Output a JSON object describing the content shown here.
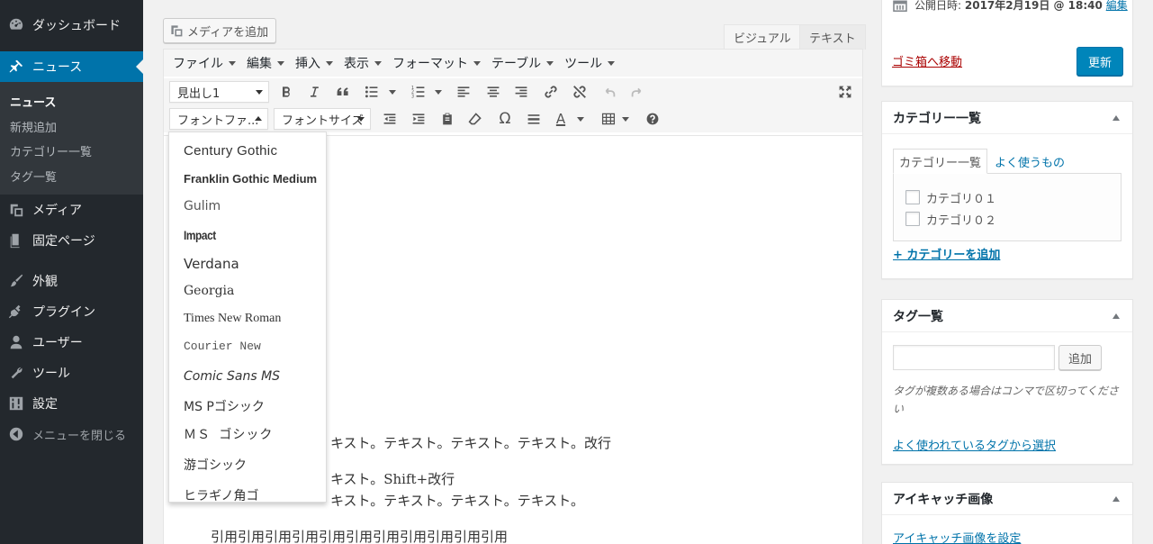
{
  "sidebar": {
    "items": [
      {
        "label": "ダッシュボード",
        "icon": "dashboard-icon"
      },
      {
        "label": "ニュース",
        "icon": "pin-icon",
        "active": true
      },
      {
        "label": "メディア",
        "icon": "media-icon"
      },
      {
        "label": "固定ページ",
        "icon": "page-icon"
      },
      {
        "label": "外観",
        "icon": "brush-icon"
      },
      {
        "label": "プラグイン",
        "icon": "plugin-icon"
      },
      {
        "label": "ユーザー",
        "icon": "user-icon"
      },
      {
        "label": "ツール",
        "icon": "wrench-icon"
      },
      {
        "label": "設定",
        "icon": "settings-icon"
      }
    ],
    "submenu": [
      "ニュース",
      "新規追加",
      "カテゴリー一覧",
      "タグ一覧"
    ],
    "collapse_label": "メニューを閉じる"
  },
  "editor": {
    "add_media_label": "メディアを追加",
    "tab_visual": "ビジュアル",
    "tab_text": "テキスト",
    "menubar": [
      "ファイル",
      "編集",
      "挿入",
      "表示",
      "フォーマット",
      "テーブル",
      "ツール"
    ],
    "format_select": "見出し1",
    "font_family_select": "フォントファ...",
    "font_size_select": "フォントサイズ",
    "text_color_glyph": "A",
    "omega_glyph": "Ω",
    "content_lines": [
      "キスト。テキスト。テキスト。テキスト。改行",
      "キスト。Shift+改行",
      "キスト。テキスト。テキスト。テキスト。",
      "引用引用引用引用引用引用引用引用引用引用引用"
    ]
  },
  "font_dropdown": {
    "options": [
      {
        "label": "Century Gothic"
      },
      {
        "label": "Franklin Gothic Medium"
      },
      {
        "label": "Gulim"
      },
      {
        "label": "Impact"
      },
      {
        "label": "Verdana"
      },
      {
        "label": "Georgia"
      },
      {
        "label": "Times New Roman"
      },
      {
        "label": "Courier New"
      },
      {
        "label": "Comic Sans MS"
      },
      {
        "label": "MS Pゴシック"
      },
      {
        "label": "ＭＳ ゴシック"
      },
      {
        "label": "游ゴシック"
      },
      {
        "label": "ヒラギノ角ゴ"
      }
    ]
  },
  "publish": {
    "publish_date_label": "公開日時:",
    "publish_date_value": "2017年2月19日 @ 18:40",
    "edit_link": "編集",
    "trash_link": "ゴミ箱へ移動",
    "update_button": "更新"
  },
  "categories": {
    "title": "カテゴリー一覧",
    "tab_all": "カテゴリー一覧",
    "tab_popular": "よく使うもの",
    "items": [
      "カテゴリ０１",
      "カテゴリ０２"
    ],
    "add_link": "+ カテゴリーを追加"
  },
  "tags": {
    "title": "タグ一覧",
    "input_value": "",
    "add_button": "追加",
    "hint": "タグが複数ある場合はコンマで区切ってください",
    "popular_link": "よく使われているタグから選択"
  },
  "featured": {
    "title": "アイキャッチ画像",
    "set_link": "アイキャッチ画像を設定"
  },
  "colors": {
    "sidebar_bg": "#23282d",
    "accent": "#0073aa",
    "trash": "#a00"
  }
}
